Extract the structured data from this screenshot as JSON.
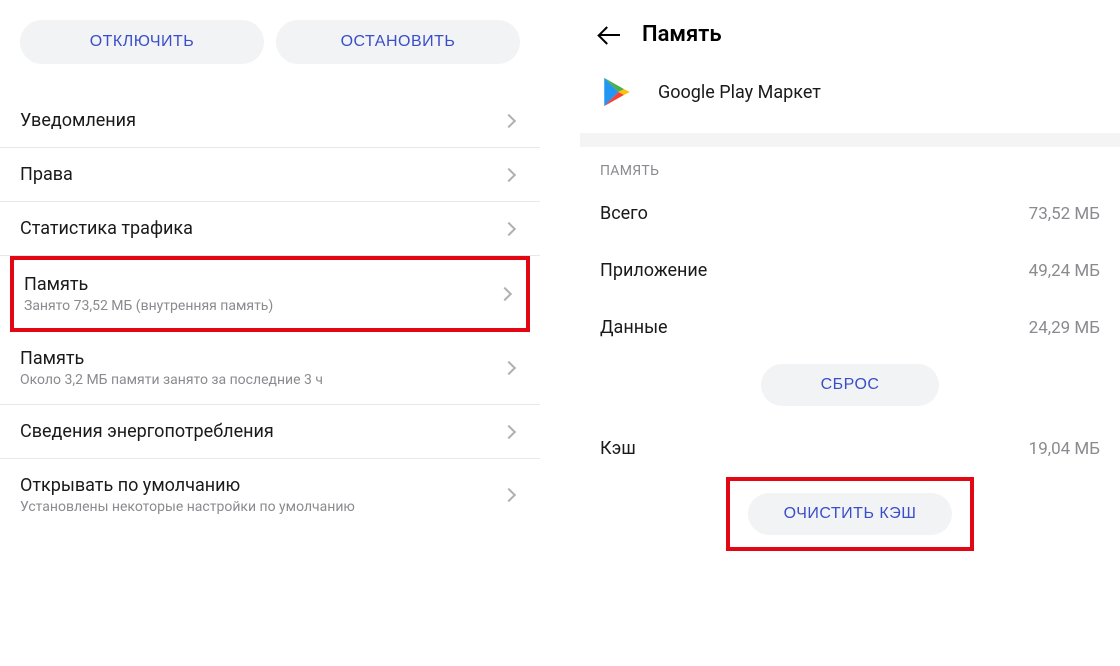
{
  "left": {
    "buttons": {
      "disable": "ОТКЛЮЧИТЬ",
      "stop": "ОСТАНОВИТЬ"
    },
    "items": [
      {
        "title": "Уведомления",
        "subtitle": null
      },
      {
        "title": "Права",
        "subtitle": null
      },
      {
        "title": "Статистика трафика",
        "subtitle": null
      },
      {
        "title": "Память",
        "subtitle": "Занято 73,52 МБ (внутренняя память)"
      },
      {
        "title": "Память",
        "subtitle": "Около 3,2 МБ памяти занято за последние 3 ч"
      },
      {
        "title": "Сведения энергопотребления",
        "subtitle": null
      },
      {
        "title": "Открывать по умолчанию",
        "subtitle": "Установлены некоторые настройки по умолчанию"
      }
    ]
  },
  "right": {
    "title": "Память",
    "app_name": "Google Play Маркет",
    "section_label": "ПАМЯТЬ",
    "rows": {
      "total": {
        "k": "Всего",
        "v": "73,52 МБ"
      },
      "app": {
        "k": "Приложение",
        "v": "49,24 МБ"
      },
      "data": {
        "k": "Данные",
        "v": "24,29 МБ"
      },
      "cache": {
        "k": "Кэш",
        "v": "19,04 МБ"
      }
    },
    "buttons": {
      "reset": "СБРОС",
      "clear_cache": "ОЧИСТИТЬ КЭШ"
    }
  }
}
